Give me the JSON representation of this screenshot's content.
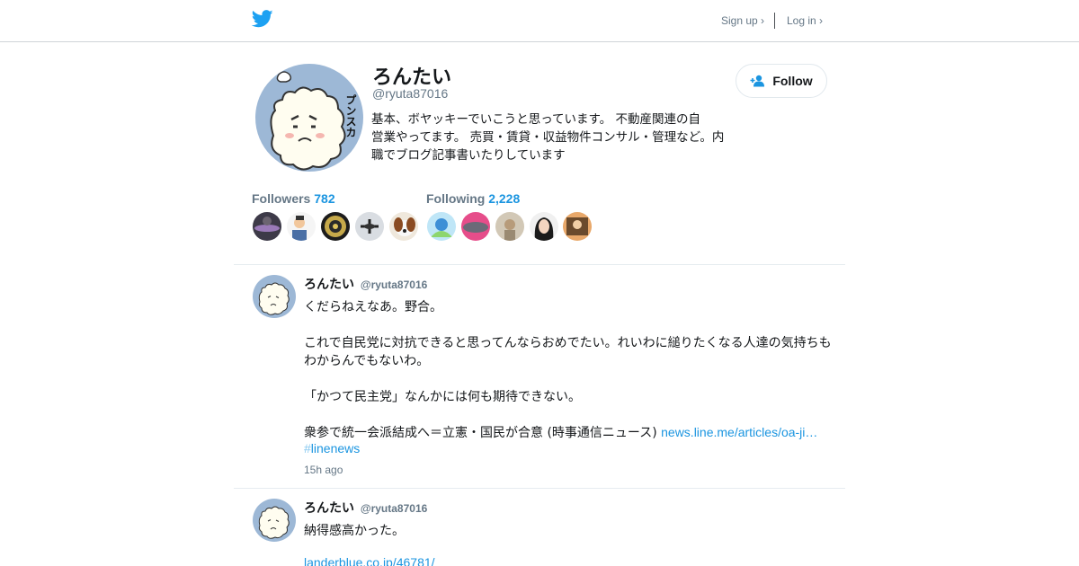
{
  "topbar": {
    "signup": "Sign up ›",
    "login": "Log in ›",
    "brand_icon": "twitter-bird-icon",
    "brand_color": "#1da1f2"
  },
  "profile": {
    "name": "ろんたい",
    "handle": "@ryuta87016",
    "bio_lines": [
      "基本、ボヤッキーでいこうと思っています。 不動産関連の自",
      "営業やってます。 売買・賃貸・収益物件コンサル・管理など。内",
      "職でブログ記事書いたりしています"
    ],
    "avatar_text": "プンスカ",
    "follow_label": "Follow",
    "follow_icon": "add-user-icon"
  },
  "stats": {
    "followers_label": "Followers",
    "followers_count": "782",
    "following_label": "Following",
    "following_count": "2,228"
  },
  "tweets": [
    {
      "name": "ろんたい",
      "handle": "@ryuta87016",
      "lines": [
        "くだらねえなあ。野合。",
        "これで自民党に対抗できると思ってんならおめでたい。れいわに縋りたくなる人達の気持ちも",
        "わからんでもないわ。",
        "「かつて民主党」なんかには何も期待できない。",
        "衆参で統一会派結成へ＝立憲・国民が合意  (時事通信ニュース) "
      ],
      "link": "news.line.me/articles/oa-ji…",
      "hashtag_mark": "#",
      "hashtag": "linenews",
      "time": "15h ago"
    },
    {
      "name": "ろんたい",
      "handle": "@ryuta87016",
      "lines": [
        "納得感高かった。"
      ],
      "link": "landerblue.co.jp/46781/"
    }
  ],
  "colors": {
    "link": "#1b95e0",
    "muted": "#657786",
    "border": "#e6ecf0"
  }
}
